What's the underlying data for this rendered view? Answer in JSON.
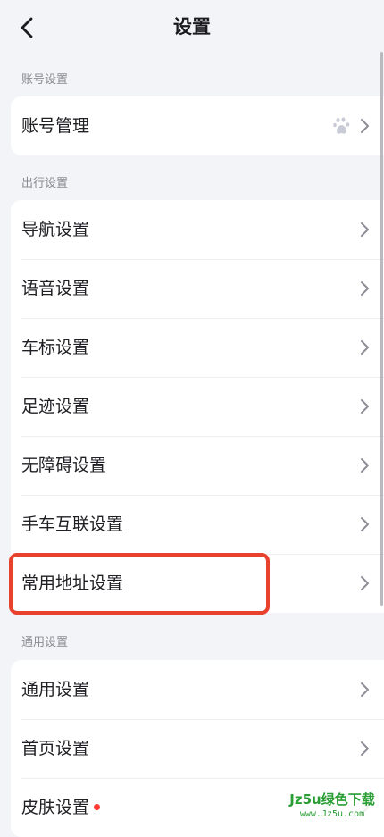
{
  "header": {
    "title": "设置"
  },
  "sections": {
    "account": {
      "label": "账号设置",
      "items": [
        {
          "label": "账号管理"
        }
      ]
    },
    "travel": {
      "label": "出行设置",
      "items": [
        {
          "label": "导航设置"
        },
        {
          "label": "语音设置"
        },
        {
          "label": "车标设置"
        },
        {
          "label": "足迹设置"
        },
        {
          "label": "无障碍设置"
        },
        {
          "label": "手车互联设置"
        },
        {
          "label": "常用地址设置"
        }
      ]
    },
    "general": {
      "label": "通用设置",
      "items": [
        {
          "label": "通用设置"
        },
        {
          "label": "首页设置"
        },
        {
          "label": "皮肤设置"
        }
      ]
    }
  },
  "highlight_color": "#e8412e",
  "notification_dot_color": "#ff3b30",
  "watermark": {
    "main": "Jz5u绿色下载",
    "sub": "www.Jz5u.com"
  }
}
